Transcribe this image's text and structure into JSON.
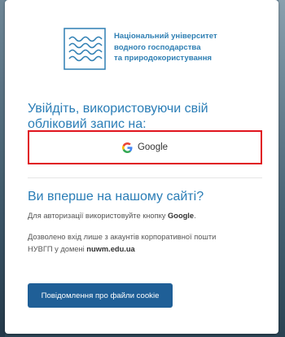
{
  "logo": {
    "icon": "waves-logo-icon",
    "line1": "Національний університет",
    "line2": "водного господарства",
    "line3": "та природокористування"
  },
  "signin": {
    "title_line1": "Увійдіть, використовуючи свій",
    "title_line2": "обліковий запис на:",
    "google_label": "Google"
  },
  "first_time": {
    "title": "Ви вперше на нашому сайті?",
    "hint_prefix": "Для авторизації використовуйте кнопку ",
    "hint_bold": "Google",
    "hint_suffix": ".",
    "domain_line1": "Дозволено вхід лише з акаунтів корпоративної пошти",
    "domain_prefix": "НУВГП у домені ",
    "domain_bold": "nuwm.edu.ua"
  },
  "cookie_button_label": "Повідомлення про файли cookie",
  "colors": {
    "accent_blue": "#2a7db6",
    "highlight_red": "#e0141e",
    "button_blue": "#1f5f97"
  }
}
